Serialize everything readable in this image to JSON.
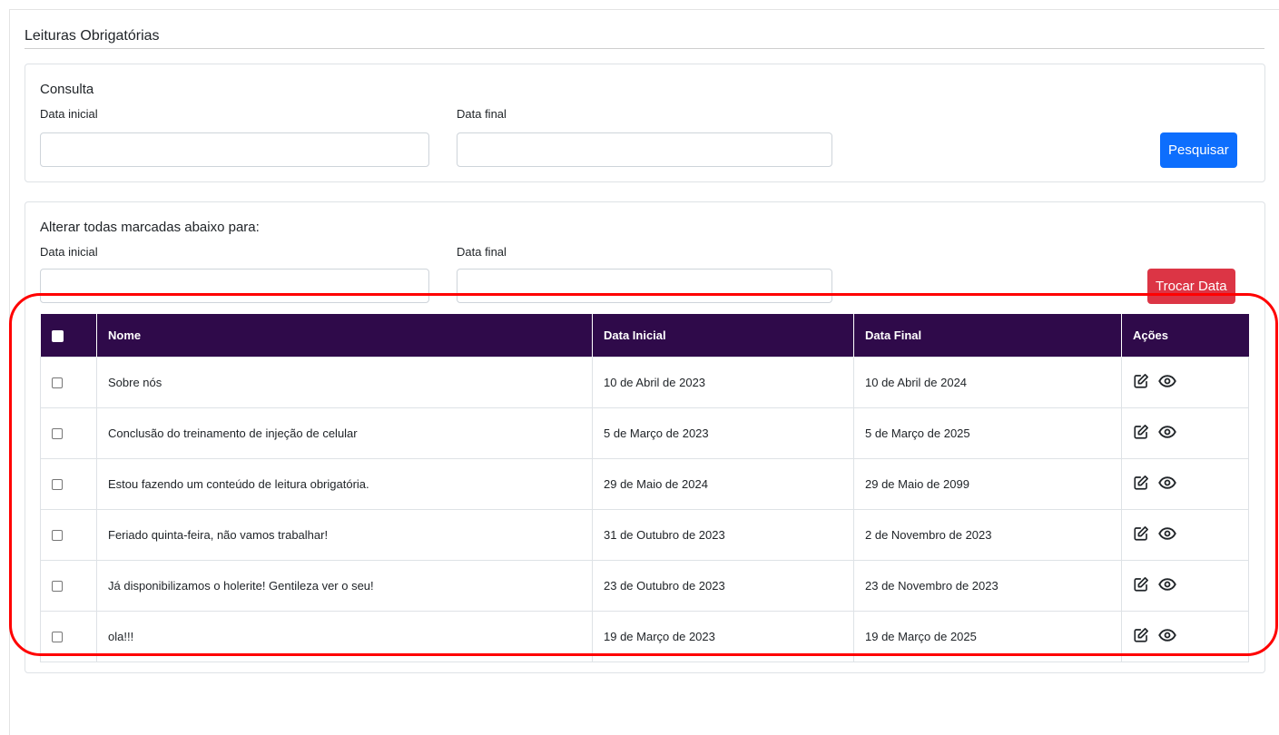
{
  "page": {
    "title": "Leituras Obrigatórias"
  },
  "consulta": {
    "heading": "Consulta",
    "start_label": "Data inicial",
    "end_label": "Data final",
    "start_value": "",
    "end_value": "",
    "search_button": "Pesquisar"
  },
  "alterar": {
    "heading": "Alterar todas marcadas abaixo para:",
    "start_label": "Data inicial",
    "end_label": "Data final",
    "start_value": "",
    "end_value": "",
    "change_button": "Trocar Data"
  },
  "table": {
    "headers": {
      "name": "Nome",
      "start": "Data Inicial",
      "end": "Data Final",
      "actions": "Ações"
    },
    "rows": [
      {
        "name": "Sobre nós",
        "start": "10 de Abril de 2023",
        "end": "10 de Abril de 2024"
      },
      {
        "name": "Conclusão do treinamento de injeção de celular",
        "start": "5 de Março de 2023",
        "end": "5 de Março de 2025"
      },
      {
        "name": "Estou fazendo um conteúdo de leitura obrigatória.",
        "start": "29 de Maio de 2024",
        "end": "29 de Maio de 2099"
      },
      {
        "name": "Feriado quinta-feira, não vamos trabalhar!",
        "start": "31 de Outubro de 2023",
        "end": "2 de Novembro de 2023"
      },
      {
        "name": "Já disponibilizamos o holerite! Gentileza ver o seu!",
        "start": "23 de Outubro de 2023",
        "end": "23 de Novembro de 2023"
      },
      {
        "name": "ola!!!",
        "start": "19 de Março de 2023",
        "end": "19 de Março de 2025"
      }
    ],
    "row_icons": [
      "edit-icon",
      "eye-icon"
    ]
  },
  "colors": {
    "header_bg": "#2f0a4a",
    "primary": "#0d6efd",
    "danger": "#dc3545",
    "highlight": "#ff0000"
  }
}
